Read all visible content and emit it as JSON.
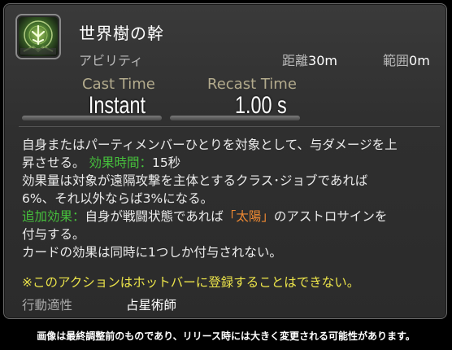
{
  "action": {
    "name": "世界樹の幹",
    "type": "アビリティ",
    "icon": "tree-of-life-icon",
    "range_label": "距離",
    "range_value": "30m",
    "radius_label": "範囲",
    "radius_value": "0m",
    "cast_label": "Cast Time",
    "cast_value": "Instant",
    "recast_label": "Recast Time",
    "recast_value": "1.00 s"
  },
  "description": {
    "l1": "自身またはパーティメンバーひとりを対象として、与ダメージを上",
    "l2a": "昇させる。  ",
    "l2_label": "効果時間：",
    "l2b": "15秒",
    "l3": "効果量は対象が遠隔攻撃を主体とするクラス･ジョブであれば",
    "l4": "6%、それ以外ならば3%になる。",
    "l5_label": "追加効果：",
    "l5a": "自身が戦闘状態であれば",
    "l5_highlight": "「太陽」",
    "l5b": "のアストロサインを",
    "l6": "付与する。",
    "l7": "カードの効果は同時に1つしか付与されない。"
  },
  "warning": "※このアクションはホットバーに登録することはできない。",
  "class_label": "行動適性",
  "class_value": "占星術師",
  "footer": "画像は最終調整前のものであり、リリース時には大きく変更される可能性があります。",
  "colors": {
    "effect_label": "#46c13c",
    "highlight": "#f08a32",
    "warning": "#ece44a"
  }
}
